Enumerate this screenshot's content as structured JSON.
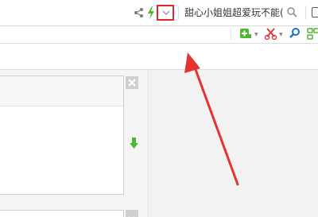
{
  "addressbar": {
    "search_text": "甜心小姐姐超爱玩不能(",
    "icons": [
      "share-icon",
      "lightning-icon",
      "chevron-down-icon",
      "search-icon",
      "window-icon"
    ]
  },
  "toolbar": {
    "icons": [
      "add-extension-icon",
      "scissors-icon",
      "find-icon",
      "grid-icon"
    ]
  },
  "colors": {
    "highlight": "#e02626",
    "green": "#52b531",
    "red_tool": "#e23b3b",
    "blue_tool": "#1a73c9"
  }
}
